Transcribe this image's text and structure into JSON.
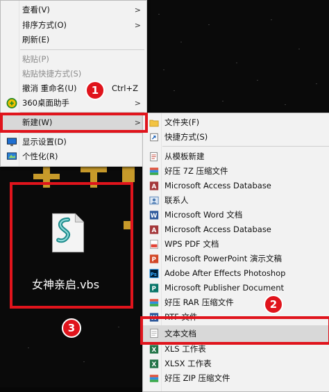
{
  "context_menu": {
    "items": [
      {
        "label": "查看(V)",
        "submenu": true
      },
      {
        "label": "排序方式(O)",
        "submenu": true
      },
      {
        "label": "刷新(E)"
      },
      {
        "label": "粘贴(P)",
        "disabled": true
      },
      {
        "label": "粘贴快捷方式(S)",
        "disabled": true
      },
      {
        "label": "撤消 重命名(U)",
        "shortcut": "Ctrl+Z"
      },
      {
        "label": "360桌面助手",
        "submenu": true,
        "icon": "360-assistant-icon"
      },
      {
        "label": "新建(W)",
        "submenu": true,
        "highlighted": true
      },
      {
        "label": "显示设置(D)",
        "icon": "display-settings-icon"
      },
      {
        "label": "个性化(R)",
        "icon": "personalize-icon"
      }
    ]
  },
  "new_submenu": {
    "items": [
      {
        "label": "文件夹(F)",
        "icon": "folder-icon"
      },
      {
        "label": "快捷方式(S)",
        "icon": "shortcut-icon"
      },
      {
        "label": "从模板新建",
        "icon": "template-icon"
      },
      {
        "label": "好压 7Z 压缩文件",
        "icon": "haozip-7z-icon"
      },
      {
        "label": "Microsoft Access Database",
        "icon": "access-icon"
      },
      {
        "label": "联系人",
        "icon": "contact-icon"
      },
      {
        "label": "Microsoft Word 文档",
        "icon": "word-icon"
      },
      {
        "label": "Microsoft Access Database",
        "icon": "access-icon"
      },
      {
        "label": "WPS PDF 文档",
        "icon": "wps-pdf-icon"
      },
      {
        "label": "Microsoft PowerPoint 演示文稿",
        "icon": "powerpoint-icon"
      },
      {
        "label": "Adobe After Effects Photoshop",
        "icon": "photoshop-icon"
      },
      {
        "label": "Microsoft Publisher Document",
        "icon": "publisher-icon"
      },
      {
        "label": "好压 RAR 压缩文件",
        "icon": "haozip-rar-icon"
      },
      {
        "label": "RTF 文件",
        "icon": "rtf-icon"
      },
      {
        "label": "文本文档",
        "icon": "text-document-icon",
        "highlighted": true
      },
      {
        "label": "XLS 工作表",
        "icon": "xls-icon"
      },
      {
        "label": "XLSX 工作表",
        "icon": "xlsx-icon"
      },
      {
        "label": "好压 ZIP 压缩文件",
        "icon": "haozip-zip-icon"
      }
    ]
  },
  "desktop_file": {
    "name": "女神亲启.vbs",
    "icon": "vbs-script-icon"
  },
  "annotations": {
    "step1": "1",
    "step2": "2",
    "step3": "3"
  },
  "colors": {
    "annotation_red": "#e0141c",
    "menu_bg": "#f2f2f2",
    "highlight": "#d8d8d8"
  }
}
